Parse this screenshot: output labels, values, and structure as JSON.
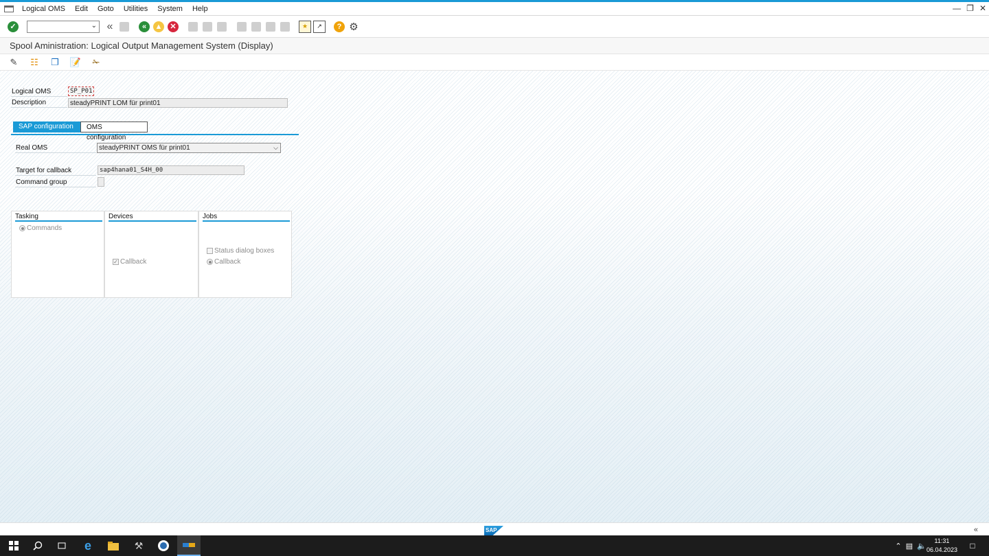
{
  "menubar": {
    "items": [
      "Logical OMS",
      "Edit",
      "Goto",
      "Utilities",
      "System",
      "Help"
    ]
  },
  "toolbar": {
    "command_value": ""
  },
  "title": "Spool Aministration: Logical Output Management System (Display)",
  "form": {
    "logical_oms_label": "Logical OMS",
    "logical_oms_value": "SP_P01",
    "description_label": "Description",
    "description_value": "steadyPRINT LOM für print01"
  },
  "tabs": [
    {
      "label": "SAP configuration",
      "active": true
    },
    {
      "label": "OMS configuration",
      "active": false
    }
  ],
  "sap_config": {
    "real_oms_label": "Real OMS",
    "real_oms_value": "steadyPRINT OMS für print01",
    "target_callback_label": "Target for callback",
    "target_callback_value": "sap4hana01_S4H_00",
    "command_group_label": "Command group",
    "command_group_value": ""
  },
  "groups": {
    "tasking": {
      "title": "Tasking",
      "commands_label": "Commands",
      "commands_selected": true
    },
    "devices": {
      "title": "Devices",
      "callback_label": "Callback",
      "callback_checked": true
    },
    "jobs": {
      "title": "Jobs",
      "status_dialog_label": "Status dialog boxes",
      "status_dialog_checked": false,
      "callback_label": "Callback",
      "callback_selected": true
    }
  },
  "statusbar": {
    "logo": "SAP",
    "collapse_glyph": "«"
  },
  "taskbar": {
    "time": "11:31",
    "date": "06.04.2023"
  },
  "colors": {
    "accent": "#1a9ad6",
    "ok_green": "#2a8f3a",
    "cancel_red": "#d7263d",
    "help_orange": "#f0a30a"
  }
}
